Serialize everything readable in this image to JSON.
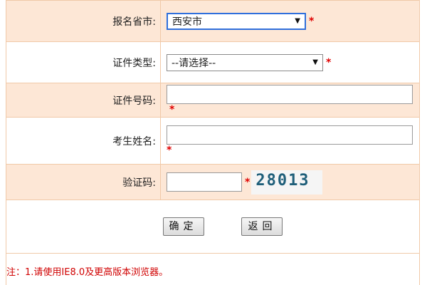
{
  "form": {
    "province_label": "报名省市:",
    "province_value": "西安市",
    "cert_type_label": "证件类型:",
    "cert_type_value": "--请选择--",
    "cert_no_label": "证件号码:",
    "name_label": "考生姓名:",
    "captcha_label": "验证码:",
    "captcha_image_text": "28013",
    "required_mark": "*"
  },
  "buttons": {
    "confirm": "确定",
    "back": "返回"
  },
  "note": "注：1.请使用IE8.0及更高版本浏览器。",
  "colors": {
    "row_accent": "#fde7d6",
    "border": "#f0c9a8",
    "required": "#e00000",
    "focus": "#2f6fdc"
  }
}
